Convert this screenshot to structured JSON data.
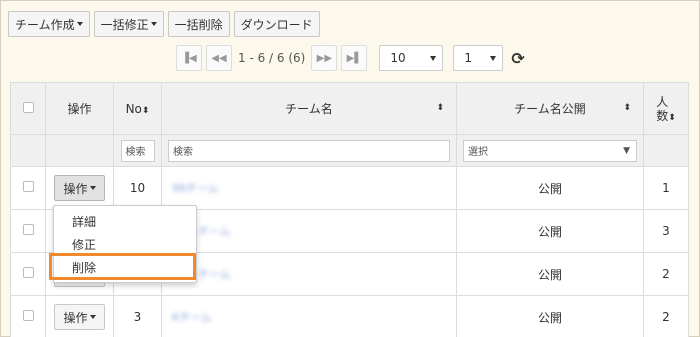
{
  "toolbar": {
    "team_create": "チーム作成",
    "bulk_edit": "一括修正",
    "bulk_delete": "一括削除",
    "download": "ダウンロード"
  },
  "pager": {
    "first": "first-page",
    "prev": "prev-page",
    "info": "1 - 6 / 6 (6)",
    "next": "next-page",
    "last": "last-page",
    "per_page": "10",
    "page": "1"
  },
  "table": {
    "headers": {
      "operation": "操作",
      "no": "No",
      "team_name": "チーム名",
      "team_public": "チーム名公開",
      "members": "人数"
    },
    "filters": {
      "no_placeholder": "検索",
      "name_placeholder": "検索",
      "public_select": "選択"
    },
    "rows": [
      {
        "op": "操作",
        "no": "10",
        "name": "99チーム",
        "public": "公開",
        "members": "1"
      },
      {
        "op": "操作",
        "no": "",
        "name": "チーム",
        "public": "公開",
        "members": "3"
      },
      {
        "op": "操作",
        "no": "",
        "name": "チーム",
        "public": "公開",
        "members": "2"
      },
      {
        "op": "操作",
        "no": "3",
        "name": "Kチーム",
        "public": "公開",
        "members": "2"
      }
    ]
  },
  "menu": {
    "detail": "詳細",
    "edit": "修正",
    "delete": "削除"
  },
  "colors": {
    "highlight": "#f08a2c",
    "background": "#fdf8ec"
  }
}
